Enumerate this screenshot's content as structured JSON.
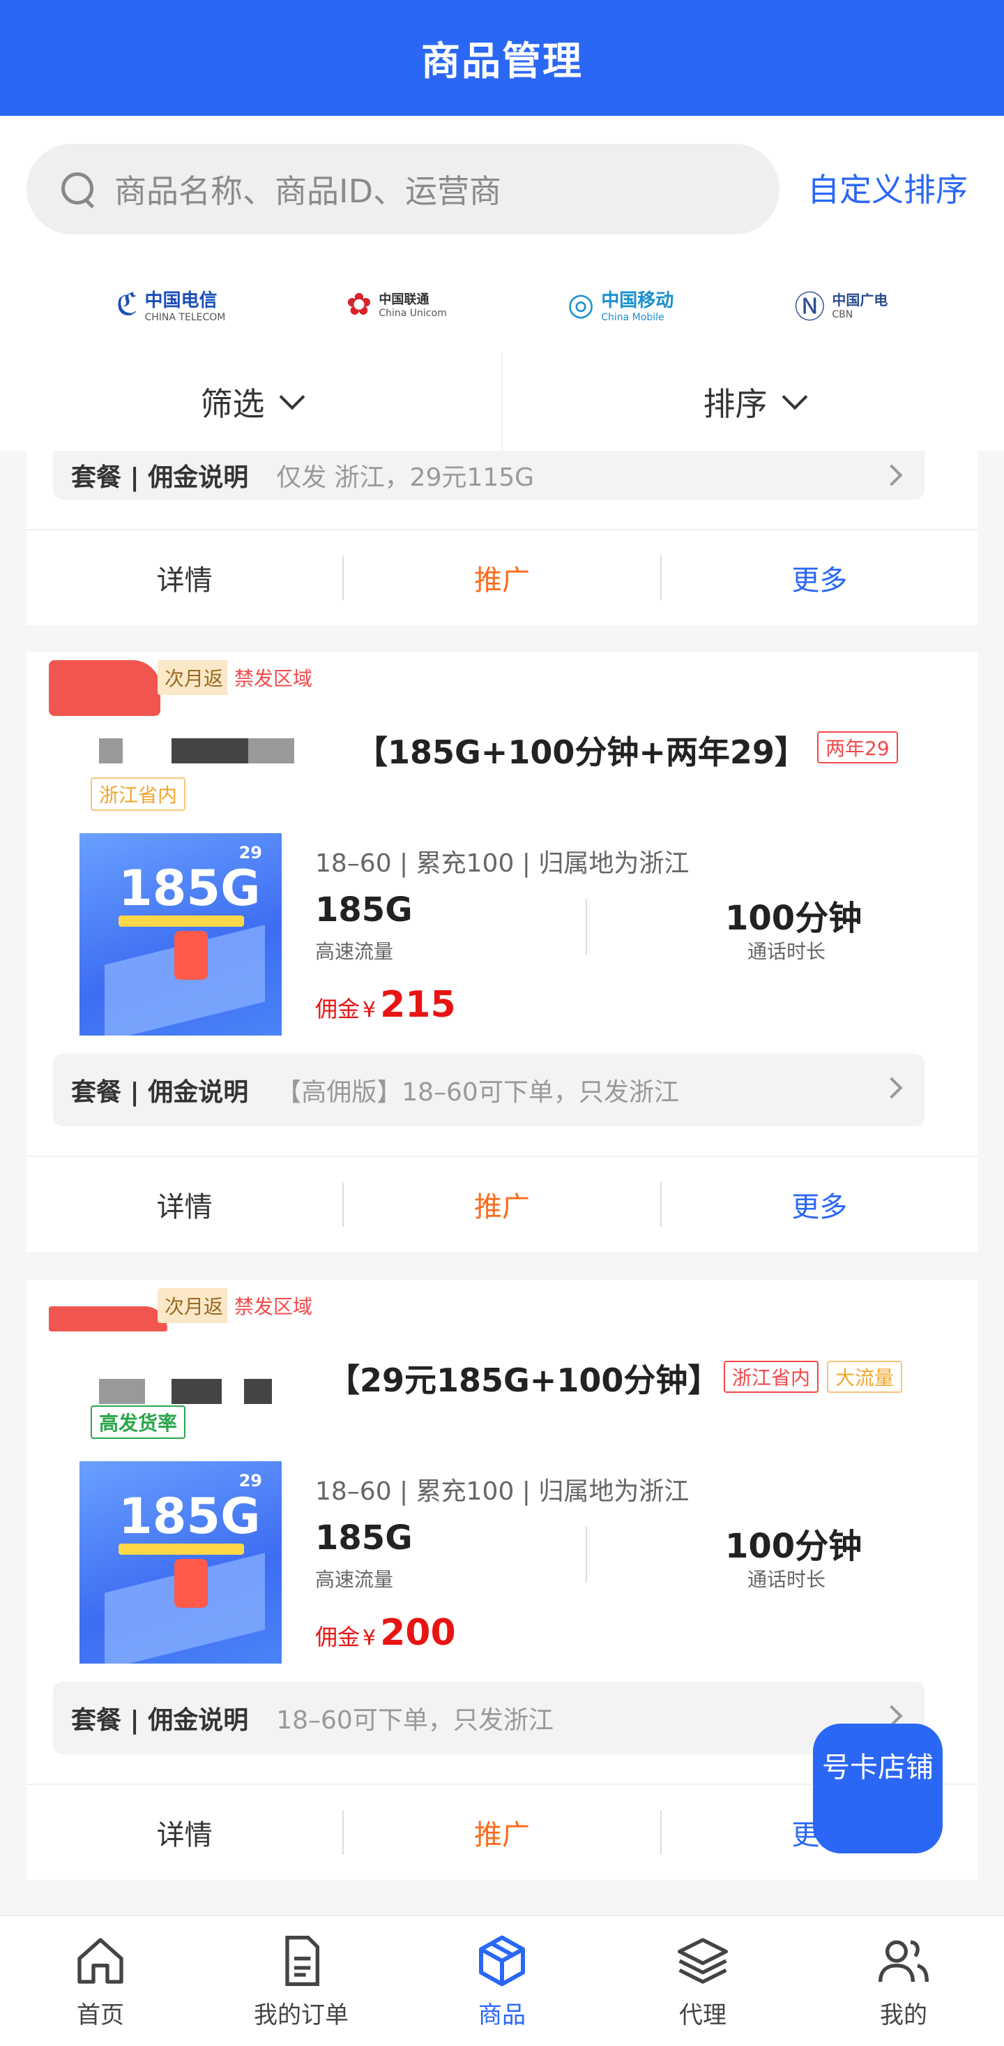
{
  "header": {
    "title": "商品管理"
  },
  "search": {
    "placeholder": "商品名称、商品ID、运营商",
    "custom_sort": "自定义排序"
  },
  "carriers": [
    {
      "name": "中国电信",
      "sub": "CHINA TELECOM",
      "icon": "telecom-logo",
      "color": "#1a4fb8"
    },
    {
      "name": "中国联通",
      "sub": "China Unicom",
      "icon": "unicom-logo",
      "color": "#d8232a"
    },
    {
      "name": "中国移动",
      "sub": "China Mobile",
      "icon": "mobile-logo",
      "color": "#1a8fd0"
    },
    {
      "name": "中国广电",
      "sub": "CBN",
      "icon": "cbn-logo",
      "color": "#2a4d8f"
    }
  ],
  "filters": {
    "filter_label": "筛选",
    "sort_label": "排序"
  },
  "card_top": {
    "pkg_label": "套餐 | 佣金说明",
    "pkg_text": "仅发 浙江，29元115G"
  },
  "actions": {
    "detail": "详情",
    "promote": "推广",
    "more": "更多"
  },
  "products": [
    {
      "tags_top": [
        "次月返",
        "禁发区域"
      ],
      "title": "【185G+100分钟+两年29】",
      "title_tags": [
        "两年29"
      ],
      "sub_tags": [
        "浙江省内"
      ],
      "thumb_big": "185G",
      "thumb_num": "29",
      "info": "18–60 | 累充100 | 归属地为浙江",
      "flow_value": "185G",
      "flow_label": "高速流量",
      "call_value": "100分钟",
      "call_label": "通话时长",
      "commission_label": "佣金",
      "commission_currency": "¥",
      "commission_value": "215",
      "pkg_label": "套餐 | 佣金说明",
      "pkg_text": "【高佣版】18–60可下单，只发浙江"
    },
    {
      "tags_top": [
        "次月返",
        "禁发区域"
      ],
      "title": "【29元185G+100分钟】",
      "title_tags": [
        "浙江省内",
        "大流量"
      ],
      "sub_tags": [
        "高发货率"
      ],
      "thumb_big": "185G",
      "thumb_num": "29",
      "info": "18–60 | 累充100 | 归属地为浙江",
      "flow_value": "185G",
      "flow_label": "高速流量",
      "call_value": "100分钟",
      "call_label": "通话时长",
      "commission_label": "佣金",
      "commission_currency": "¥",
      "commission_value": "200",
      "pkg_label": "套餐 | 佣金说明",
      "pkg_text": "18–60可下单，只发浙江"
    }
  ],
  "float_button": {
    "label": "号卡店铺"
  },
  "tabbar": [
    {
      "label": "首页",
      "icon": "home-icon",
      "active": false
    },
    {
      "label": "我的订单",
      "icon": "order-icon",
      "active": false
    },
    {
      "label": "商品",
      "icon": "box-icon",
      "active": true
    },
    {
      "label": "代理",
      "icon": "layers-icon",
      "active": false
    },
    {
      "label": "我的",
      "icon": "users-icon",
      "active": false
    }
  ],
  "colors": {
    "accent": "#2a67f5",
    "commission": "#e81414",
    "promote": "#ff6a1a"
  }
}
